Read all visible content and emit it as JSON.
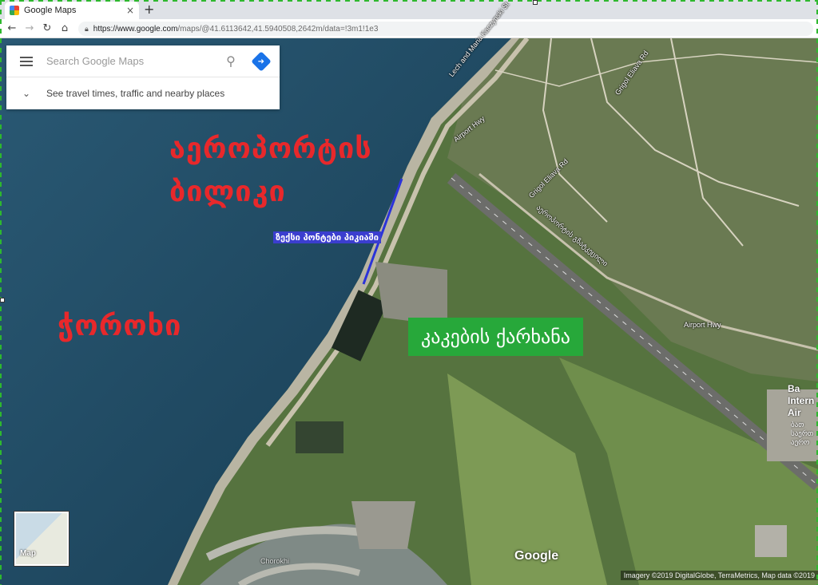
{
  "browser": {
    "tab_title": "Google Maps",
    "tab_close": "×",
    "new_tab": "+",
    "url_host": "https://www.google.com",
    "url_path": "/maps/@41.6113642,41.5940508,2642m/data=!3m1!1e3"
  },
  "search": {
    "placeholder": "Search Google Maps",
    "travel_text": "See travel times, traffic and nearby places"
  },
  "labels": {
    "airport_beach": [
      "აეროპორტის",
      "ბილიკი"
    ],
    "chorokhi": "ჭოროხი",
    "pontoon": "ზექსი პონტები პიკიაში",
    "factory": "კაკების ქარხანა"
  },
  "streets": {
    "lech_maria": "Lech and Maria Kaczynski St",
    "grigol_eliava_1": "Grigol Eliava Rd",
    "grigol_eliava_2": "Grigol Eliava Rd",
    "airport_hwy_1": "Airport Hwy",
    "airport_hwy_2": "Airport Hwy",
    "airport_geo": "აეროპორტის გზატკეცილი",
    "chorokhi_river": "Chorokhi"
  },
  "airport": {
    "name": "Ba Intern Air",
    "sub": "ბათ საერთ აერო"
  },
  "map": {
    "layer_toggle": "Map",
    "logo": "Google",
    "attribution": "Imagery ©2019 DigitalGlobe, TerraMetrics, Map data ©2019"
  },
  "colors": {
    "sea": "#1f4a63",
    "land": "#4f6b44",
    "label_red": "#e8282b",
    "label_blue": "#3b3ecf",
    "label_green": "#27a83a"
  }
}
